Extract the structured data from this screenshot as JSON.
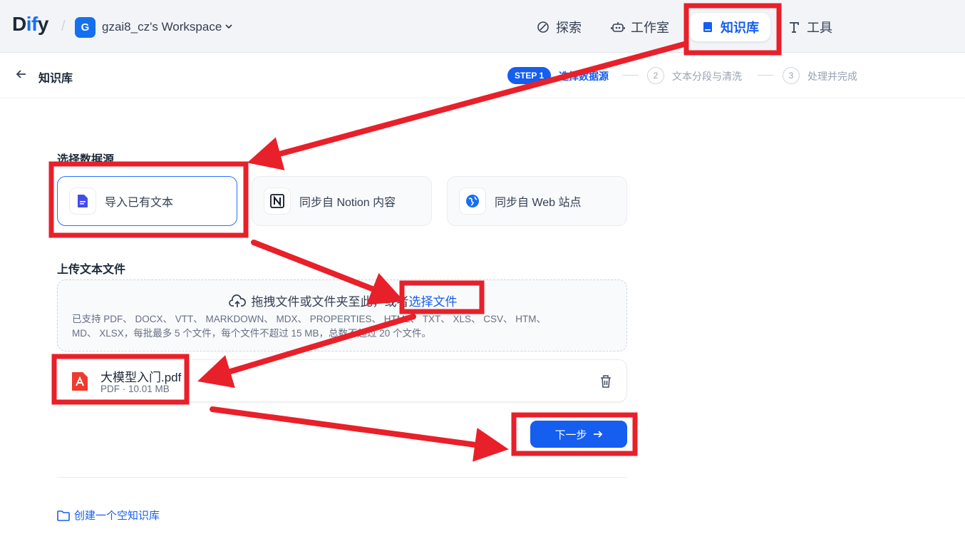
{
  "header": {
    "logo_prefix": "D",
    "logo_accent": "if",
    "logo_suffix": "y",
    "workspace_initial": "G",
    "workspace_name": "gzai8_cz's Workspace",
    "nav": [
      {
        "label": "探索",
        "icon": "compass-icon"
      },
      {
        "label": "工作室",
        "icon": "robot-icon"
      },
      {
        "label": "知识库",
        "icon": "book-icon",
        "active": true
      },
      {
        "label": "工具",
        "icon": "tool-icon"
      }
    ]
  },
  "subheader": {
    "title": "知识库",
    "step1_badge": "STEP 1",
    "step1_label": "选择数据源",
    "step2_num": "2",
    "step2_label": "文本分段与清洗",
    "step3_num": "3",
    "step3_label": "处理并完成"
  },
  "datasource": {
    "title": "选择数据源",
    "options": [
      {
        "label": "导入已有文本",
        "icon": "document-icon",
        "selected": true
      },
      {
        "label": "同步自 Notion 内容",
        "icon": "notion-icon"
      },
      {
        "label": "同步自 Web 站点",
        "icon": "globe-icon"
      }
    ]
  },
  "upload": {
    "title": "上传文本文件",
    "drop_text": "拖拽文件或文件夹至此，或者",
    "select_link": "选择文件",
    "support_line1": "已支持 PDF、 DOCX、 VTT、 MARKDOWN、 MDX、 PROPERTIES、 HTML、 TXT、 XLS、 CSV、 HTM、",
    "support_line2": "MD、 XLSX，每批最多 5 个文件，每个文件不超过 15 MB，总数不超过 20 个文件。"
  },
  "file": {
    "name": "大模型入门.pdf",
    "meta": "PDF · 10.01 MB"
  },
  "next_button": "下一步",
  "create_empty": "创建一个空知识库",
  "colors": {
    "accent": "#155eef",
    "annotation": "#e8202a"
  }
}
